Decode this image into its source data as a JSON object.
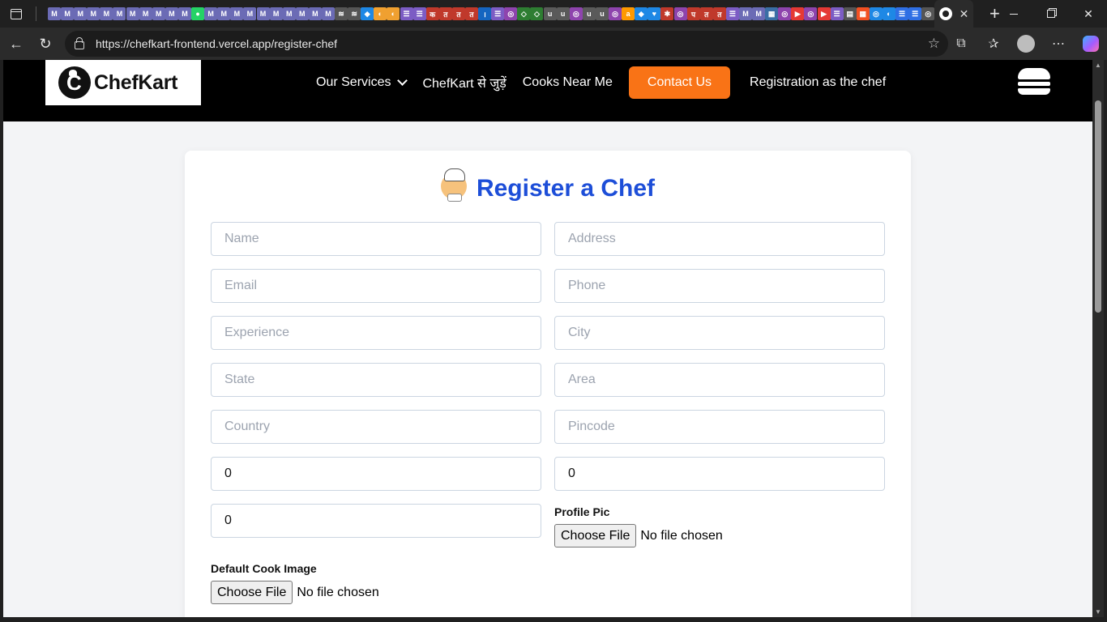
{
  "browser": {
    "url": "https://chefkart-frontend.vercel.app/register-chef",
    "tabs": [
      {
        "glyph": "M",
        "color": "#6b6bb5"
      },
      {
        "glyph": "M",
        "color": "#6b6bb5"
      },
      {
        "glyph": "M",
        "color": "#6b6bb5"
      },
      {
        "glyph": "M",
        "color": "#6b6bb5"
      },
      {
        "glyph": "M",
        "color": "#6b6bb5"
      },
      {
        "glyph": "M",
        "color": "#6b6bb5"
      },
      {
        "glyph": "M",
        "color": "#6b6bb5"
      },
      {
        "glyph": "M",
        "color": "#6b6bb5"
      },
      {
        "glyph": "M",
        "color": "#6b6bb5"
      },
      {
        "glyph": "M",
        "color": "#6b6bb5"
      },
      {
        "glyph": "M",
        "color": "#6b6bb5"
      },
      {
        "glyph": "●",
        "color": "#25d366"
      },
      {
        "glyph": "M",
        "color": "#6b6bb5"
      },
      {
        "glyph": "M",
        "color": "#6b6bb5"
      },
      {
        "glyph": "M",
        "color": "#6b6bb5"
      },
      {
        "glyph": "M",
        "color": "#6b6bb5"
      },
      {
        "glyph": "M",
        "color": "#6b6bb5"
      },
      {
        "glyph": "M",
        "color": "#6b6bb5"
      },
      {
        "glyph": "M",
        "color": "#6b6bb5"
      },
      {
        "glyph": "M",
        "color": "#6b6bb5"
      },
      {
        "glyph": "M",
        "color": "#6b6bb5"
      },
      {
        "glyph": "M",
        "color": "#6b6bb5"
      },
      {
        "glyph": "≋",
        "color": "#555"
      },
      {
        "glyph": "≋",
        "color": "#555"
      },
      {
        "glyph": "◆",
        "color": "#1e88e5"
      },
      {
        "glyph": "◐",
        "color": "#f0a030"
      },
      {
        "glyph": "◐",
        "color": "#f0a030"
      },
      {
        "glyph": "☰",
        "color": "#7c5cc4"
      },
      {
        "glyph": "☰",
        "color": "#7c5cc4"
      },
      {
        "glyph": "क",
        "color": "#c0392b"
      },
      {
        "glyph": "त",
        "color": "#c0392b"
      },
      {
        "glyph": "त",
        "color": "#c0392b"
      },
      {
        "glyph": "त",
        "color": "#c0392b"
      },
      {
        "glyph": "।",
        "color": "#1565c0"
      },
      {
        "glyph": "☰",
        "color": "#7c5cc4"
      },
      {
        "glyph": "◎",
        "color": "#8e44ad"
      },
      {
        "glyph": "◇",
        "color": "#2e7d32"
      },
      {
        "glyph": "◇",
        "color": "#2e7d32"
      },
      {
        "glyph": "u",
        "color": "#5a5a5a"
      },
      {
        "glyph": "u",
        "color": "#5a5a5a"
      },
      {
        "glyph": "◎",
        "color": "#8e44ad"
      },
      {
        "glyph": "u",
        "color": "#5a5a5a"
      },
      {
        "glyph": "u",
        "color": "#5a5a5a"
      },
      {
        "glyph": "◎",
        "color": "#8e44ad"
      },
      {
        "glyph": "a",
        "color": "#ff9900"
      },
      {
        "glyph": "◆",
        "color": "#1e88e5"
      },
      {
        "glyph": "♥",
        "color": "#1e88e5"
      },
      {
        "glyph": "✱",
        "color": "#c0392b"
      },
      {
        "glyph": "◎",
        "color": "#8e44ad"
      },
      {
        "glyph": "प",
        "color": "#c0392b"
      },
      {
        "glyph": "त",
        "color": "#c0392b"
      },
      {
        "glyph": "त",
        "color": "#c0392b"
      },
      {
        "glyph": "☰",
        "color": "#7c5cc4"
      },
      {
        "glyph": "M",
        "color": "#6b6bb5"
      },
      {
        "glyph": "M",
        "color": "#6b6bb5"
      },
      {
        "glyph": "▦",
        "color": "#3a6ea5"
      },
      {
        "glyph": "◎",
        "color": "#8e44ad"
      },
      {
        "glyph": "▶",
        "color": "#e53935"
      },
      {
        "glyph": "◎",
        "color": "#8e44ad"
      },
      {
        "glyph": "▶",
        "color": "#e53935"
      },
      {
        "glyph": "☰",
        "color": "#7c5cc4"
      },
      {
        "glyph": "▤",
        "color": "#555"
      },
      {
        "glyph": "▦",
        "color": "#f25022"
      },
      {
        "glyph": "◎",
        "color": "#1e88e5"
      },
      {
        "glyph": "◐",
        "color": "#1e88e5"
      },
      {
        "glyph": "☰",
        "color": "#2f6fe4"
      },
      {
        "glyph": "☰",
        "color": "#2f6fe4"
      },
      {
        "glyph": "◎",
        "color": "#555"
      }
    ]
  },
  "site": {
    "logo_text": "ChefKart",
    "nav": {
      "services": "Our Services",
      "join": "ChefKart से जुड़ें",
      "cooks_near_me": "Cooks Near Me",
      "contact": "Contact Us",
      "registration": "Registration as the chef"
    }
  },
  "form": {
    "title": "Register a Chef",
    "placeholders": {
      "name": "Name",
      "address": "Address",
      "email": "Email",
      "phone": "Phone",
      "experience": "Experience",
      "city": "City",
      "state": "State",
      "area": "Area",
      "country": "Country",
      "pincode": "Pincode"
    },
    "numeric_values": {
      "left_1": "0",
      "right_1": "0",
      "left_2": "0"
    },
    "profile_pic": {
      "label": "Profile Pic",
      "button": "Choose File",
      "status": "No file chosen"
    },
    "default_cook_image": {
      "label": "Default Cook Image",
      "button": "Choose File",
      "status": "No file chosen"
    }
  }
}
